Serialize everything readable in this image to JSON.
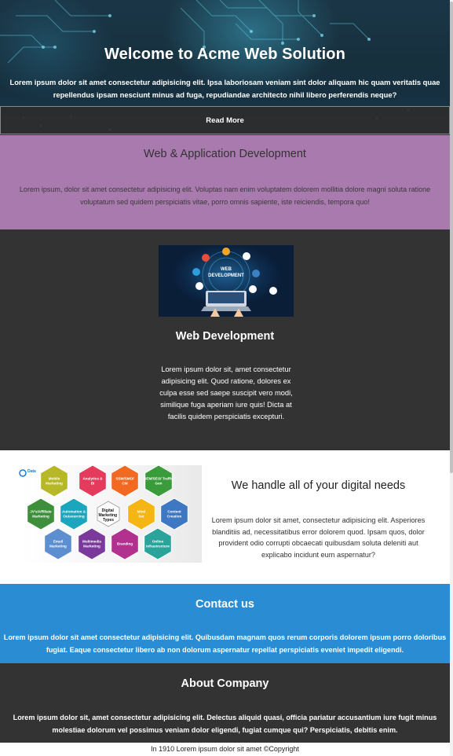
{
  "hero": {
    "title": "Welcome to Acme Web Solution",
    "text": "Lorem ipsum dolor sit amet consectetur adipisicing elit. Ipsa laboriosam veniam sint dolor aliquam hic quam veritatis quae repellendus ipsam nesciunt minus ad fuga, repudiandae architecto nihil libero perferendis neque?",
    "button_label": "Read More"
  },
  "services": {
    "title": "Web & Application Development",
    "text": "Lorem ipsum, dolor sit amet consectetur adipisicing elit. Voluptas nam enim voluptatem dolorem mollitia dolore magni soluta ratione voluptatum sed quidem perspiciatis vitae, porro omnis sapiente, iste reiciendis, tempora quo!"
  },
  "web_development": {
    "image_caption_1": "WEB",
    "image_caption_2": "DEVELOPMENT",
    "title": "Web Development",
    "text": "Lorem ipsum dolor sit, amet consectetur adipisicing elit. Quod ratione, dolores ex culpa esse sed saepe suscipit vero modi, similique fuga aperiam iure quis! Dicta at facilis quidem perspiciatis excepturi."
  },
  "digital": {
    "title": "We handle all of your digital needs",
    "text": "Lorem ipsum dolor sit amet, consectetur adipisicing elit. Asperiores blanditiis ad, necessitatibus error dolorem quod. Ipsam quos, dolor provident odio corrupti obcaecati quibusdam soluta deleniti aut explicabo incidunt eum aspernatur?",
    "image": {
      "logo": "Data",
      "center_label": "Digital Marketing Types",
      "hexagons": [
        {
          "label": "Mobile Marketing",
          "color": "#b7b827"
        },
        {
          "label": "Analytics & BI",
          "color": "#e43a5c"
        },
        {
          "label": "SSM/SMO/ CM",
          "color": "#f26a22"
        },
        {
          "label": "SEM/SEO/ Traffic Gen",
          "color": "#3a9b3a"
        },
        {
          "label": "JV's/Affiliate Marketing",
          "color": "#3d8f3b"
        },
        {
          "label": "Automation & Outsourcing",
          "color": "#1ba6bd"
        },
        {
          "label": "Mind Set",
          "color": "#f4b515"
        },
        {
          "label": "Content Creation",
          "color": "#3e78c2"
        },
        {
          "label": "Email Marketing",
          "color": "#5d8ed0"
        },
        {
          "label": "Multimedia Marketing",
          "color": "#7a3a9c"
        },
        {
          "label": "Branding",
          "color": "#b2318f"
        },
        {
          "label": "Online Infrastructure",
          "color": "#2aa39a"
        }
      ]
    }
  },
  "contact": {
    "title": "Contact us",
    "text": "Lorem ipsum dolor sit amet consectetur adipisicing elit. Quibusdam magnam quos rerum corporis dolorem ipsum porro doloribus fugiat. Eaque consectetur libero ab non dolorum aspernatur repellat perspiciatis eveniet impedit eligendi."
  },
  "about": {
    "title": "About Company",
    "text": "Lorem ipsum dolor sit, amet consectetur adipisicing elit. Delectus aliquid quasi, officia pariatur accusantium iure fugit minus molestiae dolorum vel possimus veniam dolor eligendi, fugiat cumque qui? Perspiciatis, debitis enim."
  },
  "footer": {
    "text": "In 1910 Lorem ipsum dolor sit amet ©Copyright"
  },
  "colors": {
    "hero_bg": "#173141",
    "services_bg": "#a87aad",
    "dark_bg": "#333333",
    "contact_bg": "#2a8dd4"
  }
}
